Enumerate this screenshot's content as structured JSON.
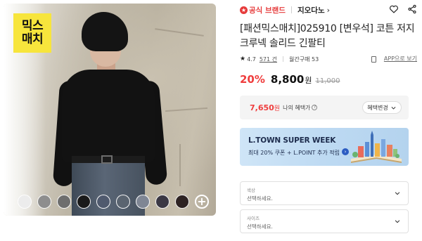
{
  "badge": {
    "line1": "믹스",
    "line2": "매치"
  },
  "swatches": {
    "colors": [
      "#ececec",
      "#8e8e8e",
      "#6e6e6e",
      "#1a1a1a",
      "#505a6e",
      "#5a6470",
      "#7f8694",
      "#3b3844",
      "#2e2323"
    ],
    "add_label": "+"
  },
  "header": {
    "official_label": "공식 브랜드",
    "store_name": "지오다노",
    "store_chevron": "›"
  },
  "product": {
    "title": "[패션믹스매치]025910 [변우석] 코튼 저지 크루넥 솔리드 긴팔티",
    "rating": "4.7",
    "reviews": "571 건",
    "monthly_sales": "월간구매 53",
    "app_link": "APP으로 보기"
  },
  "price": {
    "discount": "20%",
    "amount": "8,800",
    "currency": "원",
    "original": "11,000"
  },
  "benefit": {
    "price": "7,650",
    "currency": "원",
    "label": "나의 혜택가",
    "button": "혜택변경"
  },
  "banner": {
    "title": "L.TOWN SUPER WEEK",
    "subtitle": "최대 20% 쿠폰 + L.POINT 추가 적립"
  },
  "options": [
    {
      "label": "색상",
      "placeholder": "선택하세요."
    },
    {
      "label": "사이즈",
      "placeholder": "선택하세요."
    }
  ],
  "colors": {
    "accent_red": "#ef3d3d",
    "badge_yellow": "#f7e53c",
    "banner_blue": "#bcd9f2"
  }
}
